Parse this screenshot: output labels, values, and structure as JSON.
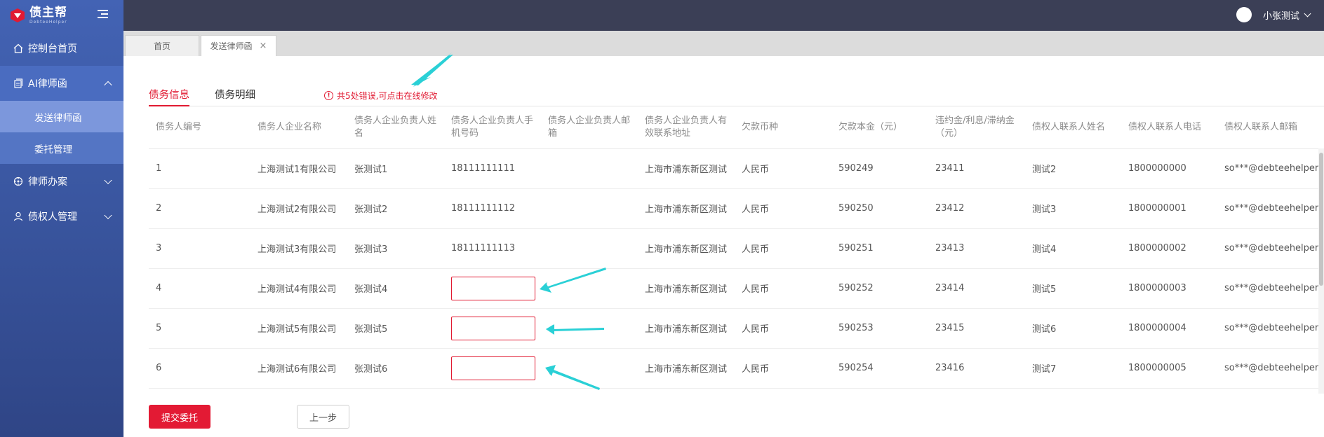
{
  "brand": {
    "name": "债主帮",
    "subtitle": "DebteeHelper"
  },
  "header": {
    "user_name": "小张测试"
  },
  "sidebar": {
    "items": [
      {
        "label": "控制台首页",
        "icon": "home-icon"
      },
      {
        "label": "AI律师函",
        "icon": "document-icon",
        "expanded": true,
        "children": [
          {
            "label": "发送律师函",
            "active": true
          },
          {
            "label": "委托管理"
          }
        ]
      },
      {
        "label": "律师办案",
        "icon": "case-icon"
      },
      {
        "label": "债权人管理",
        "icon": "user-icon"
      }
    ]
  },
  "page_tabs": {
    "home": "首页",
    "current": "发送律师函",
    "close": "×"
  },
  "subtabs": {
    "tab1": "债务信息",
    "tab2": "债务明细"
  },
  "error_message": "共5处错误,可点击在线修改",
  "table": {
    "columns": [
      "债务人编号",
      "债务人企业名称",
      "债务人企业负责人姓名",
      "债务人企业负责人手机号码",
      "债务人企业负责人邮箱",
      "债务人企业负责人有效联系地址",
      "欠款币种",
      "欠款本金（元）",
      "违约金/利息/滞纳金（元）",
      "债权人联系人姓名",
      "债权人联系人电话",
      "债权人联系人邮箱"
    ],
    "rows": [
      [
        "1",
        "上海测试1有限公司",
        "张测试1",
        "18111111111",
        "",
        "上海市浦东新区测试",
        "人民币",
        "590249",
        "23411",
        "测试2",
        "1800000000",
        "so***@debteehelper."
      ],
      [
        "2",
        "上海测试2有限公司",
        "张测试2",
        "18111111112",
        "",
        "上海市浦东新区测试",
        "人民币",
        "590250",
        "23412",
        "测试3",
        "1800000001",
        "so***@debteehelper."
      ],
      [
        "3",
        "上海测试3有限公司",
        "张测试3",
        "18111111113",
        "",
        "上海市浦东新区测试",
        "人民币",
        "590251",
        "23413",
        "测试4",
        "1800000002",
        "so***@debteehelper."
      ],
      [
        "4",
        "上海测试4有限公司",
        "张测试4",
        "",
        "",
        "上海市浦东新区测试",
        "人民币",
        "590252",
        "23414",
        "测试5",
        "1800000003",
        "so***@debteehelper."
      ],
      [
        "5",
        "上海测试5有限公司",
        "张测试5",
        "",
        "",
        "上海市浦东新区测试",
        "人民币",
        "590253",
        "23415",
        "测试6",
        "1800000004",
        "so***@debteehelper."
      ],
      [
        "6",
        "上海测试6有限公司",
        "张测试6",
        "",
        "",
        "上海市浦东新区测试",
        "人民币",
        "590254",
        "23416",
        "测试7",
        "1800000005",
        "so***@debteehelper."
      ]
    ],
    "error_rows": [
      3,
      4,
      5
    ],
    "error_column": 3
  },
  "buttons": {
    "submit": "提交委托",
    "prev": "上一步"
  },
  "colors": {
    "accent": "#e11a32",
    "sidebar": "#3b58a3",
    "topbar": "#3b3f56",
    "annotation_arrow": "#2ad0d6"
  }
}
